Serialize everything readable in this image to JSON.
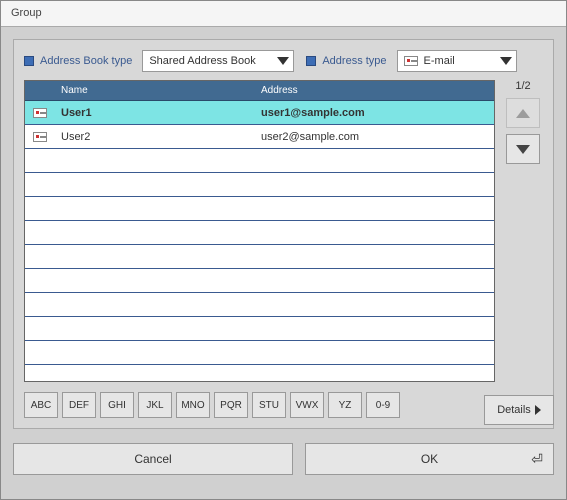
{
  "window": {
    "title": "Group"
  },
  "filters": {
    "addrbook_label": "Address Book type",
    "addrbook_value": "Shared Address Book",
    "addrtype_label": "Address type",
    "addrtype_value": "E-mail"
  },
  "table": {
    "headers": {
      "name": "Name",
      "address": "Address"
    },
    "rows": [
      {
        "name": "User1",
        "address": "user1@sample.com",
        "selected": true
      },
      {
        "name": "User2",
        "address": "user2@sample.com",
        "selected": false
      }
    ],
    "empty_rows": 9
  },
  "pager": {
    "text": "1/2"
  },
  "alpha": [
    "ABC",
    "DEF",
    "GHI",
    "JKL",
    "MNO",
    "PQR",
    "STU",
    "VWX",
    "YZ",
    "0-9"
  ],
  "buttons": {
    "details": "Details",
    "cancel": "Cancel",
    "ok": "OK"
  }
}
